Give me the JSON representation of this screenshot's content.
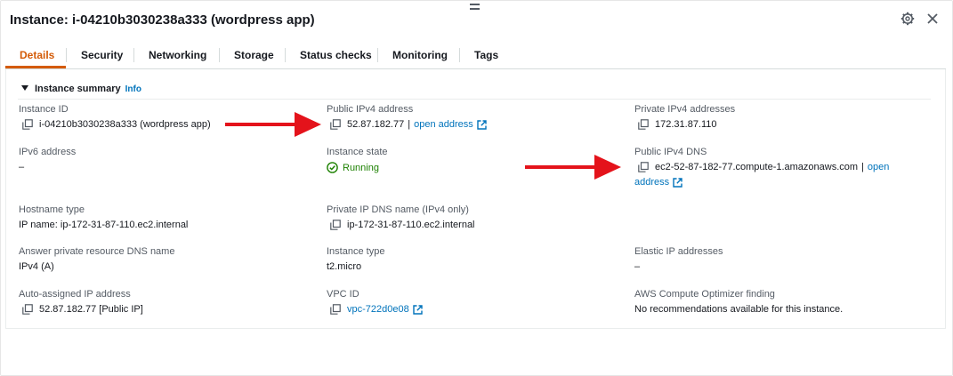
{
  "header": {
    "title": "Instance: i-04210b3030238a333 (wordpress app)"
  },
  "tabs": [
    {
      "label": "Details",
      "active": true
    },
    {
      "label": "Security"
    },
    {
      "label": "Networking"
    },
    {
      "label": "Storage"
    },
    {
      "label": "Status checks"
    },
    {
      "label": "Monitoring"
    },
    {
      "label": "Tags"
    }
  ],
  "summary": {
    "title": "Instance summary",
    "info": "Info"
  },
  "fields": {
    "instance_id": {
      "label": "Instance ID",
      "value": "i-04210b3030238a333 (wordpress app)"
    },
    "public_ipv4": {
      "label": "Public IPv4 address",
      "value": "52.87.182.77",
      "sep": "|",
      "link": "open address"
    },
    "private_ipv4": {
      "label": "Private IPv4 addresses",
      "value": "172.31.87.110"
    },
    "ipv6": {
      "label": "IPv6 address",
      "value": "–"
    },
    "instance_state": {
      "label": "Instance state",
      "value": "Running"
    },
    "public_dns": {
      "label": "Public IPv4 DNS",
      "value": "ec2-52-87-182-77.compute-1.amazonaws.com",
      "sep": "|",
      "link_1": "open",
      "link_2": "address"
    },
    "hostname_type": {
      "label": "Hostname type",
      "value": "IP name: ip-172-31-87-110.ec2.internal"
    },
    "private_dns": {
      "label": "Private IP DNS name (IPv4 only)",
      "value": "ip-172-31-87-110.ec2.internal"
    },
    "answer_dns": {
      "label": "Answer private resource DNS name",
      "value": "IPv4 (A)"
    },
    "instance_type": {
      "label": "Instance type",
      "value": "t2.micro"
    },
    "elastic_ip": {
      "label": "Elastic IP addresses",
      "value": "–"
    },
    "auto_ip": {
      "label": "Auto-assigned IP address",
      "value": "52.87.182.77 [Public IP]"
    },
    "vpc_id": {
      "label": "VPC ID",
      "value": "vpc-722d0e08"
    },
    "optimizer": {
      "label": "AWS Compute Optimizer finding",
      "value": "No recommendations available for this instance."
    }
  },
  "colors": {
    "active_tab": "#d45b07",
    "link": "#0073bb",
    "running": "#1d8102",
    "annotation_arrow": "#e4131b"
  },
  "icons": [
    "drag-handle-icon",
    "gear-icon",
    "close-icon",
    "copy-icon",
    "external-link-icon",
    "check-circle-icon",
    "caret-down-icon",
    "red-arrow-annotation"
  ]
}
